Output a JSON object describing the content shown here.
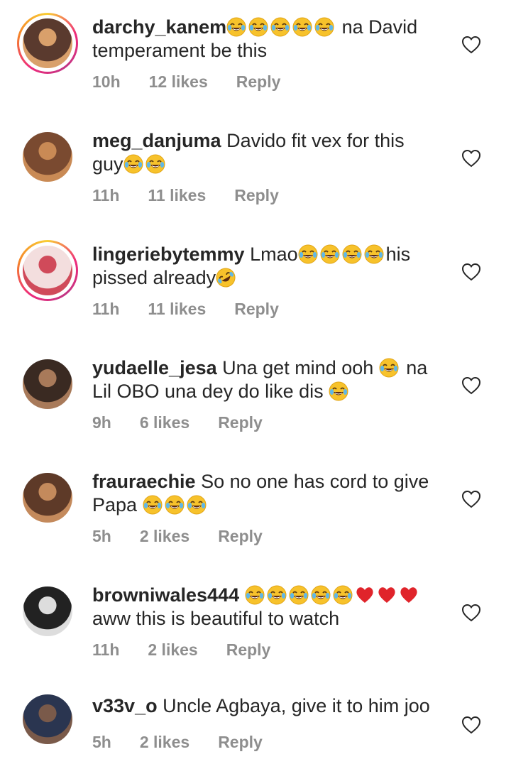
{
  "comments": [
    {
      "username": "darchy_kanem",
      "before": "",
      "emojis": [
        "joy",
        "joy",
        "joy",
        "joy",
        "joy"
      ],
      "after": " na David temperament be this",
      "time": "10h",
      "likes": "12 likes",
      "reply": "Reply",
      "story_ring": true,
      "avatar_colors": [
        "#5a3a2e",
        "#d9a06b"
      ]
    },
    {
      "username": "meg_danjuma",
      "before": " Davido fit vex for this guy",
      "emojis": [
        "joy",
        "joy"
      ],
      "after": "",
      "time": "11h",
      "likes": "11 likes",
      "reply": "Reply",
      "story_ring": false,
      "avatar_colors": [
        "#7a4a30",
        "#c98a55"
      ]
    },
    {
      "username": "lingeriebytemmy",
      "before": " Lmao",
      "emojis": [
        "joy",
        "joy",
        "joy",
        "joy"
      ],
      "after": "his pissed already",
      "after_emojis": [
        "rofl"
      ],
      "time": "11h",
      "likes": "11 likes",
      "reply": "Reply",
      "story_ring": true,
      "avatar_colors": [
        "#f3dede",
        "#d04a5a"
      ]
    },
    {
      "username": "yudaelle_jesa",
      "before": " Una get mind ooh ",
      "emojis": [
        "joy"
      ],
      "after": " na Lil OBO una dey do like dis ",
      "after_emojis": [
        "joy"
      ],
      "time": "9h",
      "likes": "6 likes",
      "reply": "Reply",
      "story_ring": false,
      "avatar_colors": [
        "#3a2a22",
        "#a87a5a"
      ]
    },
    {
      "username": "frauraechie",
      "before": " So no one has cord to give Papa ",
      "emojis": [
        "joy",
        "joy",
        "joy"
      ],
      "after": "",
      "time": "5h",
      "likes": "2 likes",
      "reply": "Reply",
      "story_ring": false,
      "avatar_colors": [
        "#5e3a28",
        "#c48a5c"
      ]
    },
    {
      "username": "browniwales444",
      "before": " ",
      "emojis": [
        "joy",
        "joy",
        "joy",
        "joy",
        "joy",
        "heart",
        "heart",
        "heart"
      ],
      "after": " aww this is beautiful to watch",
      "time": "11h",
      "likes": "2 likes",
      "reply": "Reply",
      "story_ring": false,
      "avatar_colors": [
        "#222222",
        "#dddddd"
      ]
    },
    {
      "username": "v33v_o",
      "before": " Uncle Agbaya, give it to him joo",
      "emojis": [],
      "after": "",
      "time": "5h",
      "likes": "2 likes",
      "reply": "Reply",
      "story_ring": false,
      "avatar_colors": [
        "#2a3550",
        "#7a5a4a"
      ]
    }
  ],
  "icons": {
    "like": "heart-outline-icon",
    "emoji_joy": "face-with-tears-of-joy",
    "emoji_rofl": "rolling-on-the-floor-laughing",
    "emoji_heart": "red-heart"
  },
  "colors": {
    "text": "#262626",
    "meta": "#8e8e8e",
    "emoji_yellow": "#f7c22b",
    "heart_red": "#e0242b"
  }
}
